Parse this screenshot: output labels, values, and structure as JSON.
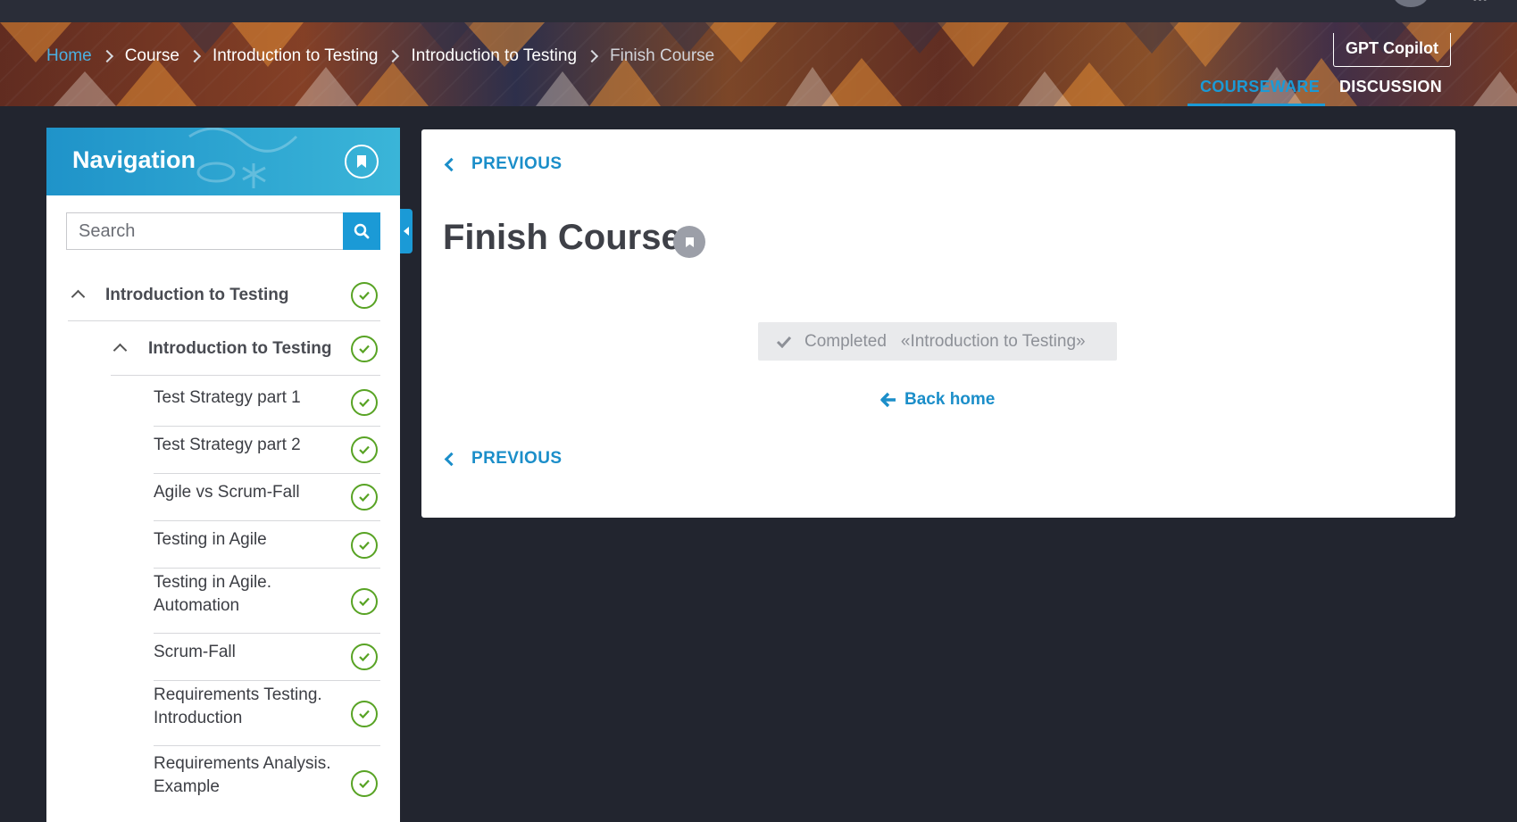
{
  "breadcrumb": {
    "items": [
      "Home",
      "Course",
      "Introduction to Testing",
      "Introduction to Testing",
      "Finish Course"
    ]
  },
  "header": {
    "copilot_label": "GPT Copilot",
    "tabs": [
      {
        "label": "COURSEWARE",
        "active": true
      },
      {
        "label": "DISCUSSION",
        "active": false
      }
    ]
  },
  "sidebar": {
    "title": "Navigation",
    "search_placeholder": "Search",
    "section": {
      "label": "Introduction to Testing",
      "expanded": true,
      "status": "completed"
    },
    "subsection": {
      "label": "Introduction to Testing",
      "expanded": true,
      "status": "completed"
    },
    "units": [
      {
        "label": "Test Strategy part 1",
        "status": "completed"
      },
      {
        "label": "Test Strategy part 2",
        "status": "completed"
      },
      {
        "label": "Agile vs Scrum-Fall",
        "status": "completed"
      },
      {
        "label": "Testing in Agile",
        "status": "completed"
      },
      {
        "label": "Testing in Agile. Automation",
        "status": "completed"
      },
      {
        "label": "Scrum-Fall",
        "status": "completed"
      },
      {
        "label": "Requirements Testing. Introduction",
        "status": "completed"
      },
      {
        "label": "Requirements Analysis. Example",
        "status": "completed"
      }
    ]
  },
  "main": {
    "previous_label": "PREVIOUS",
    "title": "Finish Course",
    "completed_label": "Completed",
    "completed_course": "«Introduction to Testing»",
    "back_home_label": "Back home"
  },
  "colors": {
    "accent": "#1b9ad6",
    "success": "#58a324",
    "background": "#22252f"
  },
  "icons": [
    "bookmark-icon",
    "search-icon",
    "check-circle-icon",
    "chevron-up-icon",
    "chevron-left-icon",
    "arrow-left-icon",
    "checkmark-icon",
    "caret-left-icon"
  ]
}
